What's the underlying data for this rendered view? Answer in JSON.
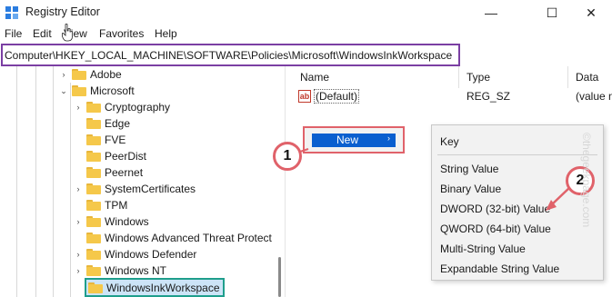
{
  "window": {
    "title": "Registry Editor",
    "minimize_glyph": "—",
    "maximize_glyph": "☐",
    "close_glyph": "✕"
  },
  "menu": [
    "File",
    "Edit",
    "View",
    "Favorites",
    "Help"
  ],
  "address": {
    "path": "Computer\\HKEY_LOCAL_MACHINE\\SOFTWARE\\Policies\\Microsoft\\WindowsInkWorkspace"
  },
  "tree": {
    "items": [
      {
        "label": "Adobe",
        "expander": "›"
      },
      {
        "label": "Microsoft",
        "expander": "⌄"
      },
      {
        "label": "Cryptography",
        "expander": "›"
      },
      {
        "label": "Edge",
        "expander": ""
      },
      {
        "label": "FVE",
        "expander": ""
      },
      {
        "label": "PeerDist",
        "expander": ""
      },
      {
        "label": "Peernet",
        "expander": ""
      },
      {
        "label": "SystemCertificates",
        "expander": "›"
      },
      {
        "label": "TPM",
        "expander": ""
      },
      {
        "label": "Windows",
        "expander": "›"
      },
      {
        "label": "Windows Advanced Threat Protect",
        "expander": ""
      },
      {
        "label": "Windows Defender",
        "expander": "›"
      },
      {
        "label": "Windows NT",
        "expander": "›"
      },
      {
        "label": "WindowsInkWorkspace",
        "expander": ""
      }
    ]
  },
  "list": {
    "columns": [
      "Name",
      "Type",
      "Data"
    ],
    "rows": [
      {
        "icon": "ab",
        "name": "(Default)",
        "type": "REG_SZ",
        "data": "(value n"
      }
    ]
  },
  "context_menu": {
    "new_label": "New",
    "new_arrow": "›",
    "submenu": [
      "Key",
      "String Value",
      "Binary Value",
      "DWORD (32-bit) Value",
      "QWORD (64-bit) Value",
      "Multi-String Value",
      "Expandable String Value"
    ]
  },
  "annotations": {
    "step1": "1",
    "step2": "2",
    "highlight_color": "#e0626a",
    "address_highlight_color": "#7b3fa3",
    "selection_highlight_color": "#1f9e8c"
  },
  "watermark": "©thegeekpage.com",
  "colors": {
    "accent": "#0a5fcf",
    "folder": "#f5c84a",
    "selection": "#cce4f7"
  }
}
